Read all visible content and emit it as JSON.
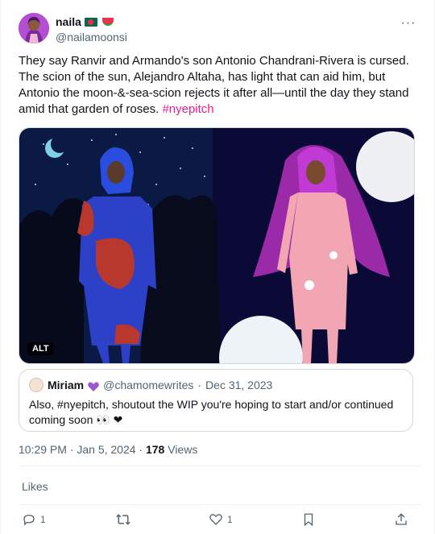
{
  "author": {
    "display_name": "naila",
    "handle": "@nailamoonsi"
  },
  "more_icon": "ellipsis-icon",
  "tweet": {
    "text_main": "They say Ranvir and Armando's son Antonio Chandrani-Rivera is cursed. The scion of the sun, Alejandro Altaha, has light that can aid him, but Antonio the moon-&-sea-scion rejects it after all—until the day they stand amid that garden of roses. ",
    "hashtag": "#nyepitch"
  },
  "media": {
    "alt_label": "ALT"
  },
  "quote": {
    "display_name": "Miriam",
    "handle": "@chamomewrites",
    "separator": "·",
    "date": "Dec 31, 2023",
    "text": "Also, #nyepitch, shoutout the WIP you're hoping to start and/or continued coming soon 👀 ❤"
  },
  "meta": {
    "time": "10:29 PM · Jan 5, 2024 · ",
    "views_count": "178",
    "views_label": " Views"
  },
  "likes_label": "Likes",
  "actions": {
    "reply_count": "1",
    "retweet_count": "",
    "like_count": "1"
  },
  "colors": {
    "accent": "#1d9bf0",
    "hashtag_pink": "#e0208c",
    "muted": "#536471",
    "heart_purple": "#9b59d0"
  }
}
